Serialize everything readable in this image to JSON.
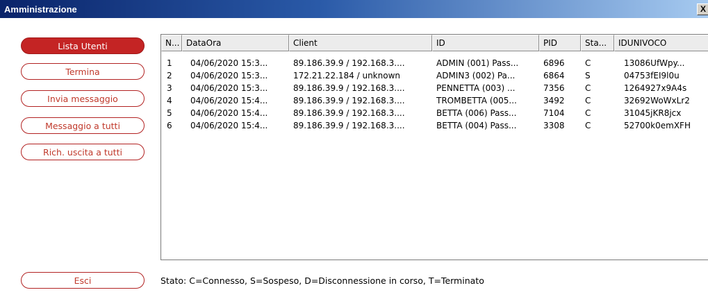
{
  "window": {
    "title": "Amministrazione",
    "close_label": "X"
  },
  "buttons": {
    "lista_utenti": "Lista Utenti",
    "termina": "Termina",
    "invia_messaggio": "Invia messaggio",
    "messaggio_a_tutti": "Messaggio a tutti",
    "rich_uscita": "Rich. uscita a tutti",
    "esci": "Esci"
  },
  "table": {
    "headers": [
      "N...",
      "DataOra",
      "Client",
      "ID",
      "PID",
      "Sta...",
      "IDUNIVOCO"
    ],
    "rows": [
      [
        "1",
        "04/06/2020 15:3...",
        "89.186.39.9 / 192.168.3....",
        "ADMIN (001) Pass...",
        "6896",
        "C",
        "13086UfWpy..."
      ],
      [
        "2",
        "04/06/2020 15:3...",
        "172.21.22.184 / unknown",
        "ADMIN3 (002) Pa...",
        "6864",
        "S",
        "04753fEI9l0u"
      ],
      [
        "3",
        "04/06/2020 15:3...",
        "89.186.39.9 / 192.168.3....",
        "PENNETTA (003) ...",
        "7356",
        "C",
        "1264927x9A4s"
      ],
      [
        "4",
        "04/06/2020 15:4...",
        "89.186.39.9 / 192.168.3....",
        "TROMBETTA (005...",
        "3492",
        "C",
        "32692WoWxLr2"
      ],
      [
        "5",
        "04/06/2020 15:4...",
        "89.186.39.9 / 192.168.3....",
        "BETTA (006) Pass...",
        "7104",
        "C",
        "31045jKR8jcx"
      ],
      [
        "6",
        "04/06/2020 15:4...",
        "89.186.39.9 / 192.168.3....",
        "BETTA (004) Pass...",
        "3308",
        "C",
        "52700k0emXFH"
      ]
    ]
  },
  "legend": "Stato: C=Connesso, S=Sospeso, D=Disconnessione in corso, T=Terminato",
  "colors": {
    "accent": "#c42424",
    "titlebar": "#0a246a"
  }
}
